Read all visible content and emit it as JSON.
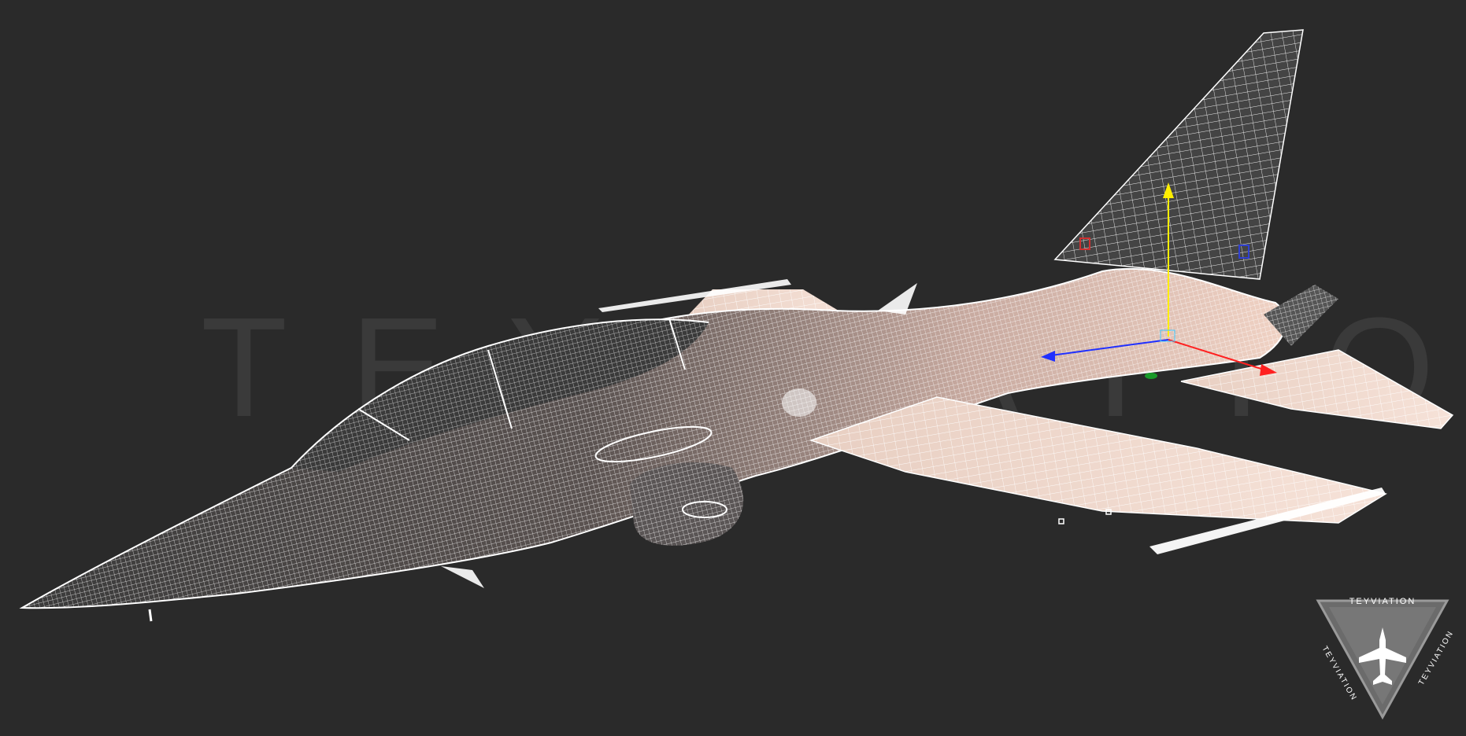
{
  "viewport": {
    "background_color": "#2a2a2a",
    "wireframe_color": "#ffffff",
    "surface_tint": "#f3d6c8"
  },
  "watermark": {
    "text": "TEYVIATION"
  },
  "gizmo": {
    "y_axis_color": "#ffee00",
    "x_axis_color": "#ff2020",
    "z_axis_color": "#2030ff",
    "marker_color": "#1a9a2a"
  },
  "logo": {
    "top_text": "TEYVIATION",
    "left_text": "TEYVIATION",
    "right_text": "TEYVIATION",
    "fill_color": "#6b6b6b",
    "border_color": "#9a9a9a"
  }
}
